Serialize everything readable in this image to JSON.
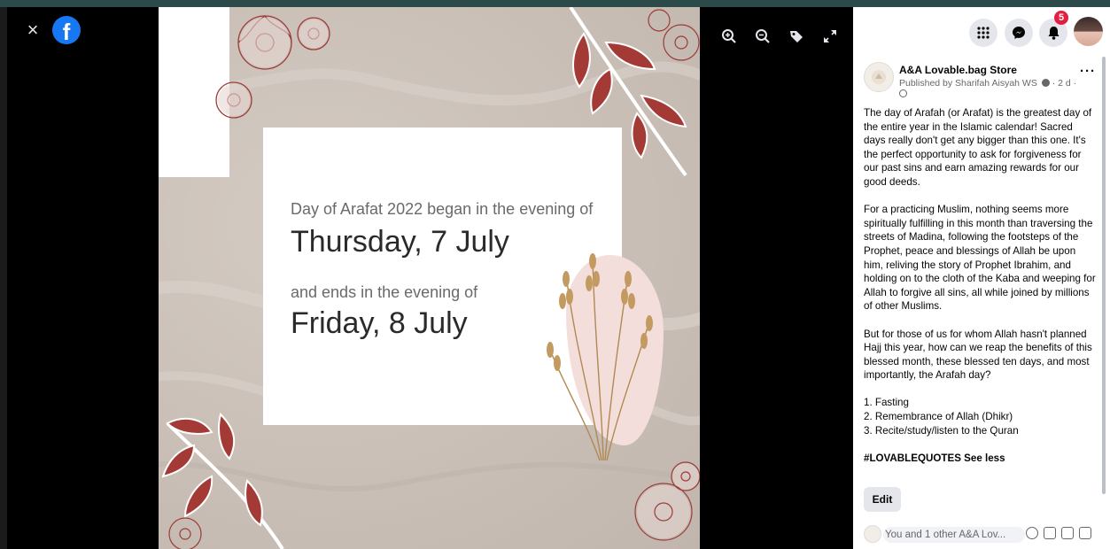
{
  "viewer": {
    "close_label": "×",
    "logo_letter": "f",
    "tools": [
      "zoom-in-icon",
      "zoom-out-icon",
      "tag-icon",
      "fullscreen-icon"
    ]
  },
  "poster": {
    "line1": "Day of Arafat 2022 began in the evening of",
    "line2": "Thursday, 7 July",
    "line3": "and ends in the evening of",
    "line4": "Friday, 8 July"
  },
  "nav": {
    "icons": [
      "menu-grid-icon",
      "messenger-icon",
      "notifications-icon"
    ],
    "notification_count": "5"
  },
  "post": {
    "page_name": "A&A Lovable.bag Store",
    "published_by": "Published by Sharifah Aisyah WS",
    "time": "· 2 d ·",
    "para1": "The day of Arafah (or Arafat) is the greatest day of the entire year in the Islamic calendar! Sacred days really don't get any bigger than this one. It's the perfect opportunity to ask for forgiveness for our past sins and earn amazing rewards for our good deeds.",
    "para2": "For a practicing Muslim, nothing seems more spiritually fulfilling in this month than traversing the streets of Madina, following the footsteps of the Prophet, peace and blessings of Allah be upon him, reliving the story of Prophet Ibrahim, and holding on to the cloth of the Kaba and weeping for Allah to forgive all sins, all while joined by millions of other Muslims.",
    "para3": "But for those of us for whom Allah hasn't planned Hajj this year, how can we reap the benefits of this blessed month, these blessed ten days, and most importantly, the Arafah day?",
    "list": [
      "1. Fasting",
      "2. Remembrance of Allah (Dhikr)",
      "3. Recite/study/listen to the Quran"
    ],
    "hashtag": "#LOVABLEQUOTES See less",
    "edit_label": "Edit",
    "comment_placeholder": "You and 1 other A&A Lov..."
  },
  "colors": {
    "facebook_blue": "#1877f2",
    "badge_red": "#e41e3f",
    "poster_bg": "#c9bfb7",
    "leaf_red": "#a33a36"
  }
}
